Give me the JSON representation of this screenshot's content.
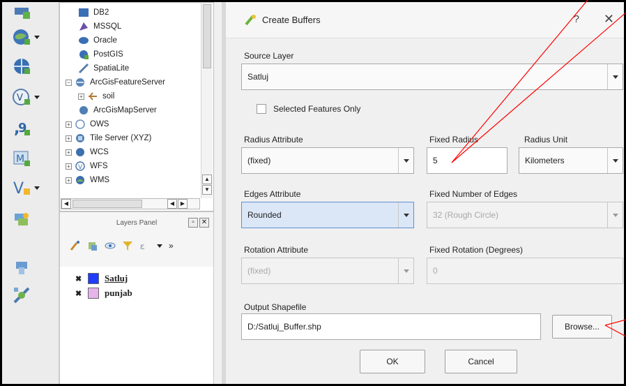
{
  "browser_tree": {
    "items": [
      {
        "label": "DB2",
        "icon": "db2-icon"
      },
      {
        "label": "MSSQL",
        "icon": "mssql-icon"
      },
      {
        "label": "Oracle",
        "icon": "oracle-icon"
      },
      {
        "label": "PostGIS",
        "icon": "postgis-icon"
      },
      {
        "label": "SpatiaLite",
        "icon": "spatialite-icon"
      },
      {
        "label": "ArcGisFeatureServer",
        "icon": "arcgis-feature-server-icon"
      },
      {
        "label": "soil",
        "icon": "feature-layer-icon"
      },
      {
        "label": "ArcGisMapServer",
        "icon": "arcgis-map-server-icon"
      },
      {
        "label": "OWS",
        "icon": "ows-icon"
      },
      {
        "label": "Tile Server (XYZ)",
        "icon": "tile-server-icon"
      },
      {
        "label": "WCS",
        "icon": "wcs-icon"
      },
      {
        "label": "WFS",
        "icon": "wfs-icon"
      },
      {
        "label": "WMS",
        "icon": "wms-icon"
      }
    ]
  },
  "layers_panel": {
    "title": "Layers Panel",
    "layers": [
      {
        "name": "Satluj",
        "color": "#1f3cff",
        "checked": "✖"
      },
      {
        "name": "punjab",
        "color": "#e6b3ea",
        "checked": "✖"
      }
    ]
  },
  "dialog": {
    "title": "Create Buffers",
    "help": "?",
    "close": "✕",
    "source_layer_label": "Source Layer",
    "source_layer_value": "Satluj",
    "selected_only_label": "Selected Features Only",
    "radius_attribute_label": "Radius Attribute",
    "radius_attribute_value": "(fixed)",
    "fixed_radius_label": "Fixed Radius",
    "fixed_radius_value": "5",
    "radius_unit_label": "Radius Unit",
    "radius_unit_value": "Kilometers",
    "edges_attribute_label": "Edges Attribute",
    "edges_attribute_value": "Rounded",
    "fixed_edges_label": "Fixed Number of Edges",
    "fixed_edges_value": "32 (Rough Circle)",
    "rotation_attribute_label": "Rotation Attribute",
    "rotation_attribute_value": "(fixed)",
    "fixed_rotation_label": "Fixed Rotation (Degrees)",
    "fixed_rotation_value": "0",
    "output_label": "Output Shapefile",
    "output_value": "D:/Satluj_Buffer.shp",
    "browse_label": "Browse...",
    "ok_label": "OK",
    "cancel_label": "Cancel"
  },
  "colors": {
    "annotation": "#ff0000",
    "focus": "#dbe7f7"
  }
}
